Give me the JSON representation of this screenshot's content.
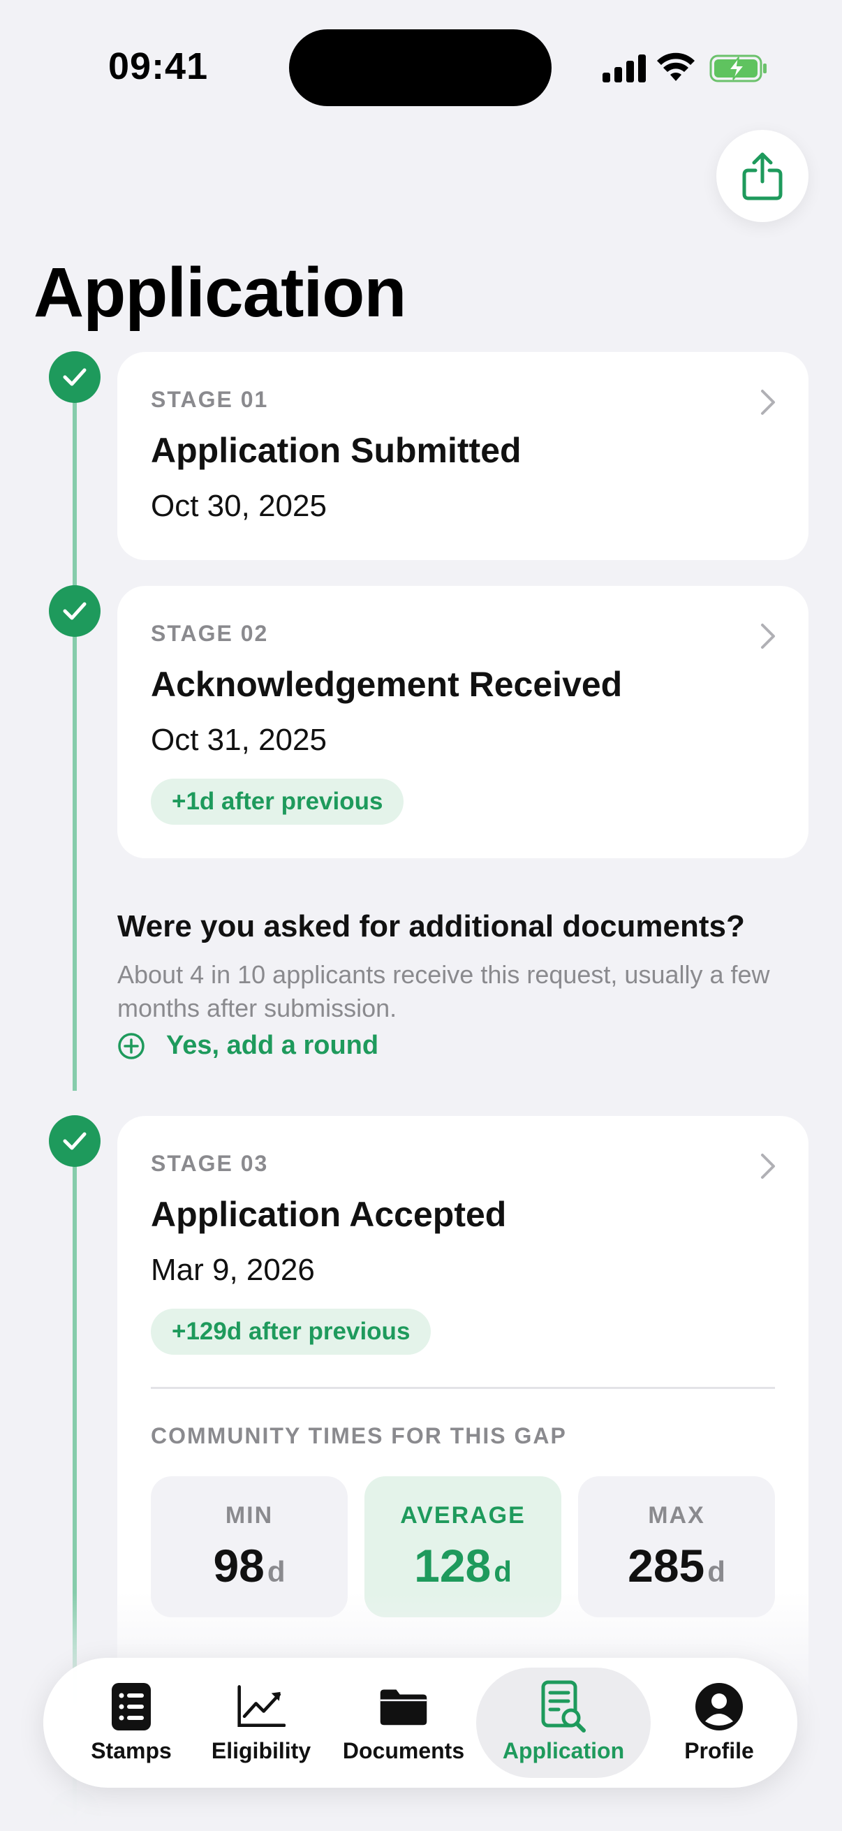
{
  "status_bar": {
    "time": "09:41"
  },
  "page": {
    "title": "Application"
  },
  "stages": [
    {
      "label": "STAGE 01",
      "title": "Application Submitted",
      "date": "Oct 30, 2025"
    },
    {
      "label": "STAGE 02",
      "title": "Acknowledgement Received",
      "date": "Oct 31, 2025",
      "gap": "+1d after previous"
    },
    {
      "label": "STAGE 03",
      "title": "Application Accepted",
      "date": "Mar 9, 2026",
      "gap": "+129d after previous"
    }
  ],
  "additional_docs": {
    "question": "Were you asked for additional documents?",
    "description": "About 4 in 10 applicants receive this request, usually a few months after submission.",
    "action": "Yes, add a round"
  },
  "community": {
    "heading": "COMMUNITY TIMES FOR THIS GAP",
    "min": {
      "label": "MIN",
      "value": "98",
      "unit": "d"
    },
    "average": {
      "label": "AVERAGE",
      "value": "128",
      "unit": "d"
    },
    "max": {
      "label": "MAX",
      "value": "285",
      "unit": "d"
    }
  },
  "tabbar": {
    "tabs": [
      {
        "label": "Stamps",
        "icon": "stamps-icon"
      },
      {
        "label": "Eligibility",
        "icon": "chart-icon"
      },
      {
        "label": "Documents",
        "icon": "folder-icon"
      },
      {
        "label": "Application",
        "icon": "document-search-icon",
        "active": true
      },
      {
        "label": "Profile",
        "icon": "profile-icon"
      }
    ]
  },
  "colors": {
    "accent": "#1e9a5c",
    "accent_light": "#e4f3ea",
    "background": "#f2f2f6",
    "timeline": "#86ccab"
  }
}
